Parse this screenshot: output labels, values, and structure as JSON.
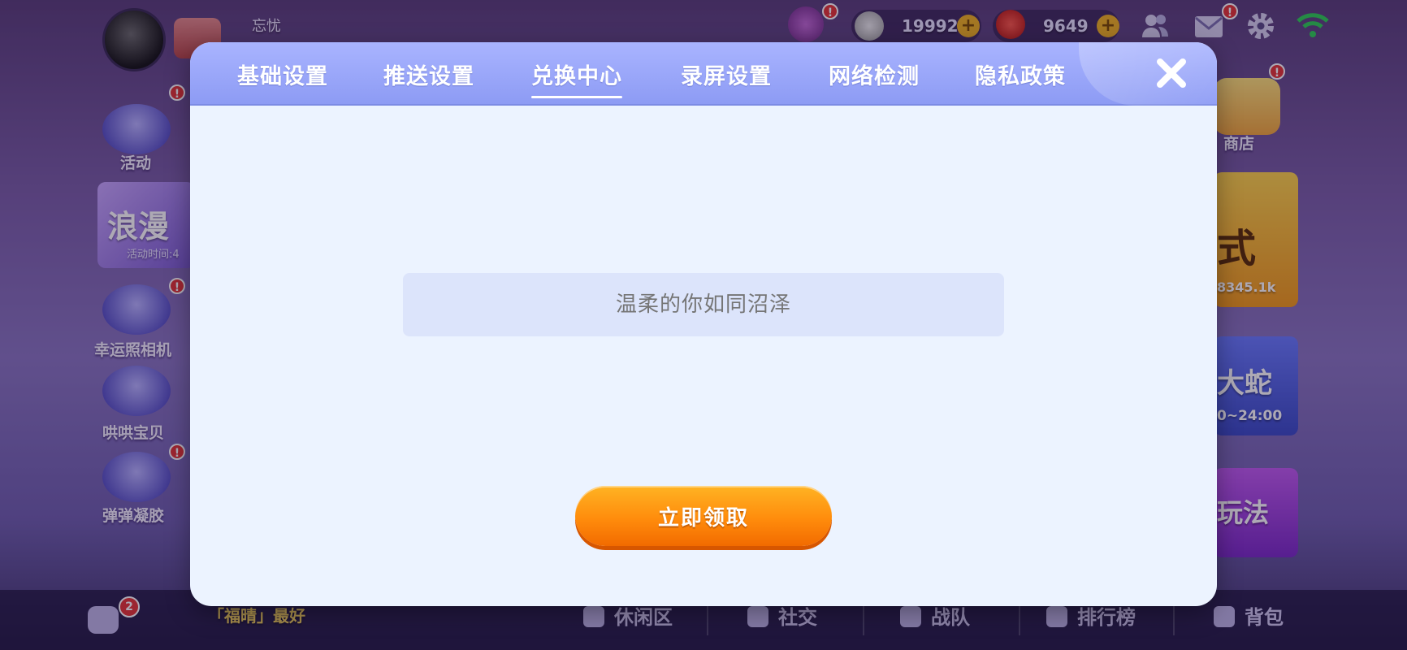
{
  "background": {
    "player": {
      "nickname": "忘忧"
    },
    "resources": {
      "coins": "19992",
      "apples": "9649"
    },
    "top_icons": [
      "bell-icon",
      "friends-icon",
      "mail-icon",
      "gear-icon",
      "wifi-icon"
    ],
    "left_menu": [
      {
        "label": "活动",
        "icon": "star-icon"
      },
      {
        "label": "幸运照相机",
        "icon": "panda-icon"
      },
      {
        "label": "哄哄宝贝",
        "icon": "baby-icon"
      },
      {
        "label": "弹弹凝胶",
        "icon": "jelly-icon"
      }
    ],
    "left_banner": {
      "title": "浪漫",
      "subtitle": "活动时间:4"
    },
    "right_menu": {
      "shop_label": "商店"
    },
    "right_banners": [
      {
        "title": "式",
        "subtitle": "8345.1k"
      },
      {
        "title": "大蛇",
        "subtitle": "0~24:00"
      },
      {
        "title": "玩法",
        "subtitle": ""
      }
    ],
    "chat": {
      "unread": "2",
      "ticker": "「福晴」最好"
    },
    "bottom_nav": [
      "休闲区",
      "社交",
      "战队",
      "排行榜",
      "背包"
    ]
  },
  "modal": {
    "tabs": [
      "基础设置",
      "推送设置",
      "兑换中心",
      "录屏设置",
      "网络检测",
      "隐私政策"
    ],
    "active_tab": "兑换中心",
    "redeem_input": {
      "placeholder": "温柔的你如同沼泽",
      "value": ""
    },
    "claim_button": "立即领取"
  },
  "colors": {
    "tab_bar": "#9aa7fa",
    "modal_bg": "#ecf3ff",
    "input_bg": "#dce4fb",
    "button_orange": "#ff8c0c"
  }
}
